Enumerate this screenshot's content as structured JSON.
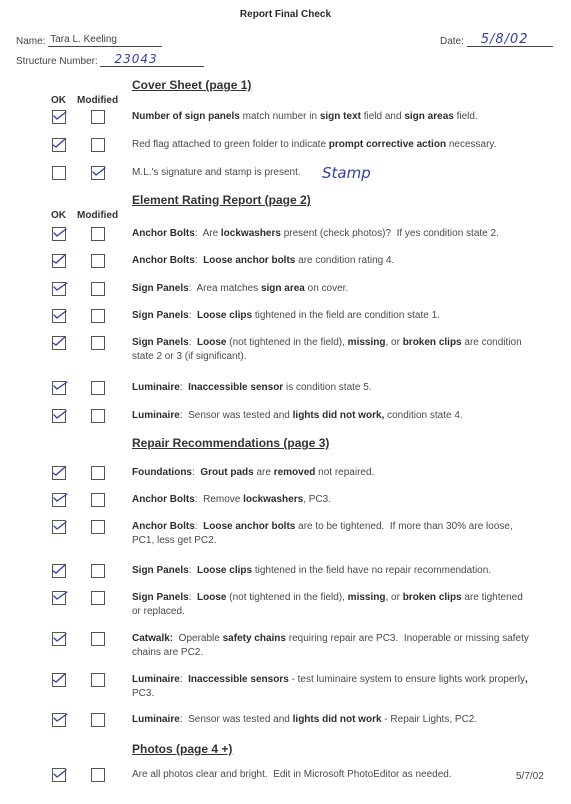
{
  "title": "Report Final Check",
  "name_label": "Name:",
  "name_value": "Tara L. Keeling",
  "structure_label": "Structure Number:",
  "structure_value": "23043",
  "date_label": "Date:",
  "date_value": "5/8/02",
  "colors": {
    "ink": "#2e3fa8",
    "text": "#3a3a3a"
  },
  "columns": {
    "ok": "OK",
    "modified": "Modified"
  },
  "sections": [
    {
      "heading": "Cover Sheet (page 1)",
      "items": [
        {
          "ok": true,
          "modified": false,
          "html": "<b>Number of sign panels</b> match number in <b>sign text</b> field and <b>sign areas</b> field."
        },
        {
          "ok": true,
          "modified": false,
          "html": "Red flag attached to green folder to indicate <b>prompt corrective action</b> necessary."
        },
        {
          "ok": false,
          "modified": true,
          "html": "M.L.'s signature and stamp is present.",
          "annotation": "Stamp"
        }
      ]
    },
    {
      "heading": "Element Rating Report (page 2)",
      "items": [
        {
          "ok": true,
          "modified": false,
          "html": "<b>Anchor Bolts</b>:&nbsp; Are <b>lockwashers</b> present (check photos)?&nbsp; If yes condition state 2."
        },
        {
          "ok": true,
          "modified": false,
          "html": "<b>Anchor Bolts</b>:&nbsp; <b>Loose anchor bolts</b> are condition rating 4."
        },
        {
          "ok": true,
          "modified": false,
          "html": "<b>Sign Panels</b>:&nbsp; Area matches <b>sign area</b> on cover."
        },
        {
          "ok": true,
          "modified": false,
          "html": "<b>Sign Panels</b>:&nbsp; <b>Loose clips</b> tightened in the field are condition state 1."
        },
        {
          "ok": true,
          "modified": false,
          "html": "<b>Sign Panels</b>:&nbsp; <b>Loose</b> (not tightened in the field), <b>missing</b>, or <b>broken clips</b> are condition state 2 or 3 (if significant)."
        },
        {
          "ok": true,
          "modified": false,
          "html": "<b>Luminaire</b>:&nbsp; <b>Inaccessible sensor</b> is condition state 5."
        },
        {
          "ok": true,
          "modified": false,
          "html": "<b>Luminaire</b>:&nbsp; Sensor was tested and <b>lights did not work,</b> condition state 4."
        }
      ]
    },
    {
      "heading": "Repair Recommendations (page 3)",
      "items": [
        {
          "ok": true,
          "modified": false,
          "html": "<b>Foundations</b>:&nbsp; <b>Grout pads</b> are <b>removed</b> not repaired."
        },
        {
          "ok": true,
          "modified": false,
          "html": "<b>Anchor Bolts</b>:&nbsp; Remove <b>lockwashers</b>, PC3."
        },
        {
          "ok": true,
          "modified": false,
          "html": "<b>Anchor Bolts</b>:&nbsp; <b>Loose anchor bolts</b> are to be tightened.&nbsp; If more than 30% are loose, PC1, less get PC2."
        },
        {
          "ok": true,
          "modified": false,
          "html": "<b>Sign Panels</b>:&nbsp; <b>Loose clips</b> tightened in the field have no repair recommendation."
        },
        {
          "ok": true,
          "modified": false,
          "html": "<b>Sign Panels</b>:&nbsp; <b>Loose</b> (not tightened in the field), <b>missing</b>, or <b>broken clips</b> are tightened or replaced."
        },
        {
          "ok": true,
          "modified": false,
          "html": "<b>Catwalk:</b>&nbsp; Operable <b>safety chains</b> requiring repair are PC3.&nbsp; Inoperable or missing safety chains are PC2."
        },
        {
          "ok": true,
          "modified": false,
          "html": "<b>Luminaire</b>:&nbsp; <b>Inaccessible sensors</b> - test luminaire system to ensure lights work properly<b>,</b> PC3."
        },
        {
          "ok": true,
          "modified": false,
          "html": "<b>Luminaire</b>:&nbsp; Sensor was tested and <b>lights did not work</b> - Repair Lights, PC2."
        }
      ]
    },
    {
      "heading": "Photos (page 4 +)",
      "items": [
        {
          "ok": true,
          "modified": false,
          "html": "Are all photos clear and bright.&nbsp; Edit in Microsoft PhotoEditor as needed."
        }
      ]
    }
  ],
  "footer_date": "5/7/02"
}
